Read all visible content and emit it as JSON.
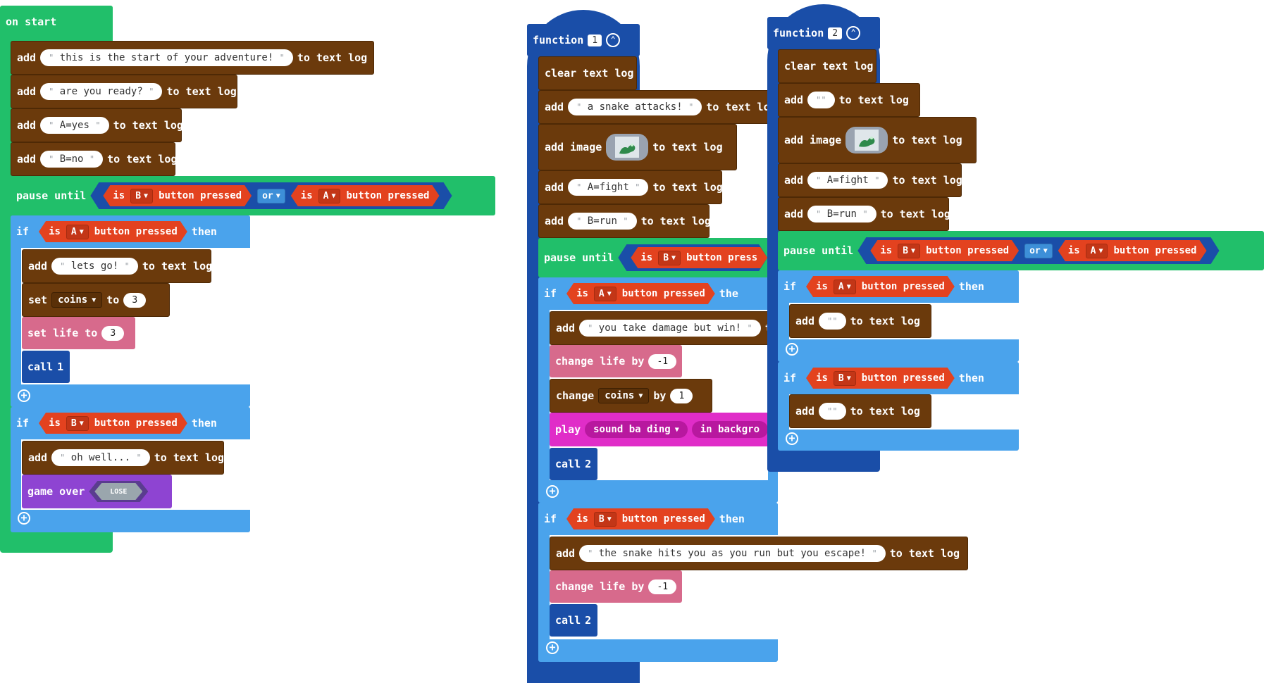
{
  "on_start": {
    "label": "on start",
    "add_1": {
      "kw": "add",
      "text": "this is the start of your adventure!",
      "suffix": "to text log"
    },
    "add_2": {
      "kw": "add",
      "text": "are you ready?",
      "suffix": "to text log"
    },
    "add_3": {
      "kw": "add",
      "text": "A=yes",
      "suffix": "to text log"
    },
    "add_4": {
      "kw": "add",
      "text": "B=no",
      "suffix": "to text log"
    },
    "pause": {
      "kw": "pause until",
      "c1_is": "is",
      "c1_btn": "B",
      "c1_tail": "button pressed",
      "or": "or",
      "c2_is": "is",
      "c2_btn": "A",
      "c2_tail": "button pressed"
    },
    "if_a": {
      "kw": "if",
      "is": "is",
      "btn": "A",
      "tail": "button pressed",
      "then": "then"
    },
    "add_lets": {
      "kw": "add",
      "text": "lets go!",
      "suffix": "to text log"
    },
    "set_coins": {
      "kw": "set",
      "var": "coins",
      "to": "to",
      "val": "3"
    },
    "set_life": {
      "kw": "set life to",
      "val": "3"
    },
    "call": {
      "kw": "call",
      "n": "1"
    },
    "if_b": {
      "kw": "if",
      "is": "is",
      "btn": "B",
      "tail": "button pressed",
      "then": "then"
    },
    "add_oh": {
      "kw": "add",
      "text": "oh well...",
      "suffix": "to text log"
    },
    "game_over": {
      "kw": "game over",
      "val": "LOSE"
    }
  },
  "function_1": {
    "kw": "function",
    "n": "1",
    "clear": "clear text log",
    "add_snake": {
      "kw": "add",
      "text": "a snake attacks!",
      "suffix": "to text log"
    },
    "add_image": {
      "kw": "add image",
      "suffix": "to text log"
    },
    "add_fight": {
      "kw": "add",
      "text": "A=fight",
      "suffix": "to text log"
    },
    "add_run": {
      "kw": "add",
      "text": "B=run",
      "suffix": "to text log"
    },
    "pause": {
      "kw": "pause until",
      "is": "is",
      "btn": "B",
      "tail": "button press"
    },
    "if_a": {
      "kw": "if",
      "is": "is",
      "btn": "A",
      "tail": "button pressed",
      "then": "the"
    },
    "add_dmg": {
      "kw": "add",
      "text": "you take damage but win!",
      "suffix": "t"
    },
    "change_life": {
      "kw": "change life by",
      "val": "-1"
    },
    "change_coins": {
      "kw": "change",
      "var": "coins",
      "by": "by",
      "val": "1"
    },
    "play": {
      "kw": "play",
      "sound": "sound ba ding",
      "tail": "in backgro"
    },
    "call_a": {
      "kw": "call",
      "n": "2"
    },
    "if_b": {
      "kw": "if",
      "is": "is",
      "btn": "B",
      "tail": "button pressed",
      "then": "then"
    },
    "add_hits": {
      "kw": "add",
      "text": "the snake hits you as you run but you escape!",
      "suffix": "to text log"
    },
    "change_life_b": {
      "kw": "change life by",
      "val": "-1"
    },
    "call_b": {
      "kw": "call",
      "n": "2"
    }
  },
  "function_2": {
    "kw": "function",
    "n": "2",
    "clear": "clear text log",
    "add_empty": {
      "kw": "add",
      "text": "",
      "suffix": "to text log"
    },
    "add_image": {
      "kw": "add image",
      "suffix": "to text log"
    },
    "add_fight": {
      "kw": "add",
      "text": "A=fight",
      "suffix": "to text log"
    },
    "add_run": {
      "kw": "add",
      "text": "B=run",
      "suffix": "to text log"
    },
    "pause": {
      "kw": "pause until",
      "c1_is": "is",
      "c1_btn": "B",
      "c1_tail": "button pressed",
      "or": "or",
      "c2_is": "is",
      "c2_btn": "A",
      "c2_tail": "button pressed"
    },
    "if_a": {
      "kw": "if",
      "is": "is",
      "btn": "A",
      "tail": "button pressed",
      "then": "then"
    },
    "add_a": {
      "kw": "add",
      "text": "",
      "suffix": "to text log"
    },
    "if_b": {
      "kw": "if",
      "is": "is",
      "btn": "B",
      "tail": "button pressed",
      "then": "then"
    },
    "add_b": {
      "kw": "add",
      "text": "",
      "suffix": "to text log"
    }
  },
  "colors": {
    "events": "#21bf6a",
    "text_log": "#6b3a0c",
    "logic": "#4aa3ec",
    "condition": "#e3421f",
    "functions": "#1a4ea8",
    "info": "#d76a8c",
    "music": "#e02dc8",
    "game": "#8e44d2"
  },
  "icons": {
    "add_block": "plus-circle-icon",
    "collapse": "chevron-up-icon",
    "dropdown": "caret-down-icon",
    "sprite": "snake-sprite-icon"
  }
}
